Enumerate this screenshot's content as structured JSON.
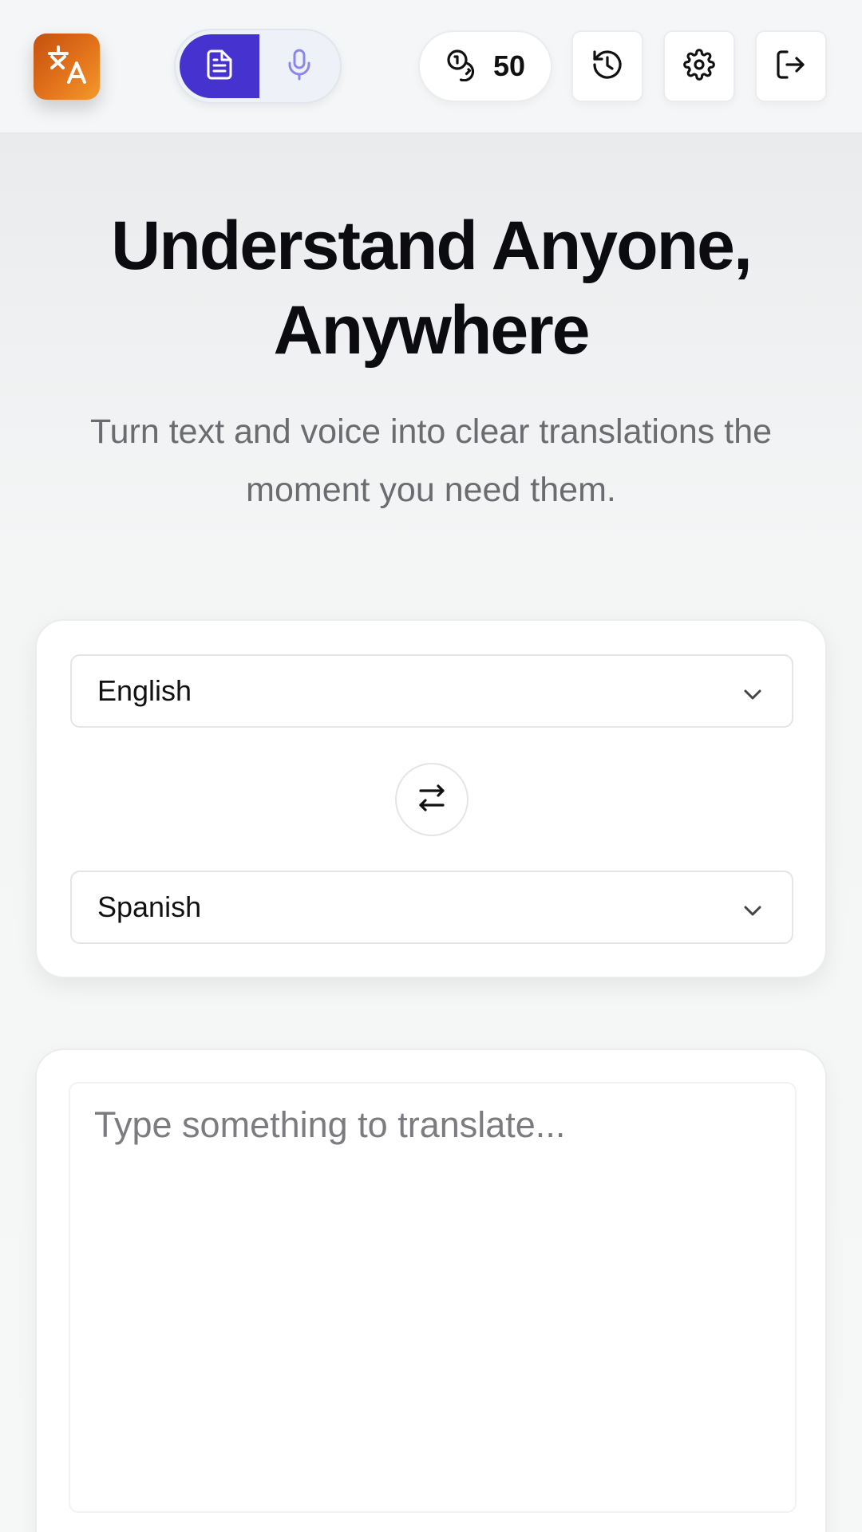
{
  "header": {
    "logo_icon": "translate-icon",
    "mode_toggle": {
      "text_mode_icon": "document-icon",
      "voice_mode_icon": "microphone-icon",
      "active": "text",
      "active_color": "#4532cf"
    },
    "credits": {
      "icon": "coins-icon",
      "count": "50"
    },
    "buttons": [
      {
        "icon": "history-icon"
      },
      {
        "icon": "gear-icon"
      },
      {
        "icon": "logout-icon"
      }
    ]
  },
  "hero": {
    "title": "Understand Anyone, Anywhere",
    "subtitle": "Turn text and voice into clear translations the moment you need them."
  },
  "languages": {
    "source": "English",
    "target": "Spanish",
    "swap_icon": "swap-arrows-icon"
  },
  "input": {
    "placeholder": "Type something to translate..."
  },
  "colors": {
    "accent": "#4532cf",
    "logo_gradient_start": "#c4500f",
    "logo_gradient_end": "#f39a2c"
  }
}
